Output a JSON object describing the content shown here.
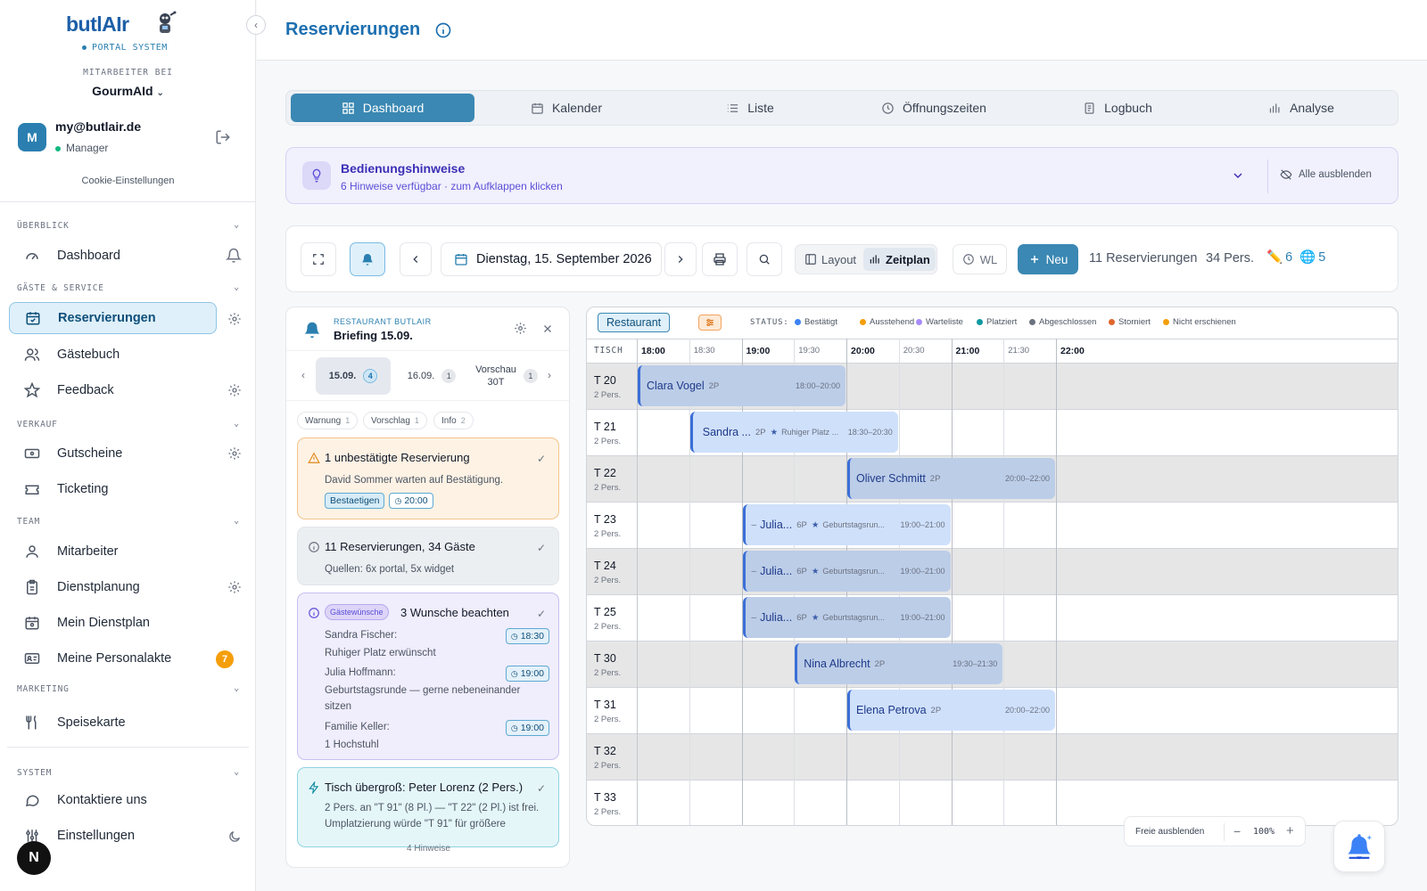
{
  "sidebar": {
    "logo": "butlAIr",
    "portal": "PORTAL SYSTEM",
    "employee_label": "MITARBEITER BEI",
    "company": "GourmAId",
    "user": {
      "initial": "M",
      "email": "my@butlair.de",
      "role": "Manager"
    },
    "cookie": "Cookie-Einstellungen",
    "sections": {
      "overview": "ÜBERBLICK",
      "guests": "GÄSTE & SERVICE",
      "sales": "VERKAUF",
      "team": "TEAM",
      "marketing": "MARKETING",
      "system": "SYSTEM"
    },
    "items": {
      "dashboard": "Dashboard",
      "reservations": "Reservierungen",
      "guestbook": "Gästebuch",
      "feedback": "Feedback",
      "vouchers": "Gutscheine",
      "ticketing": "Ticketing",
      "staff": "Mitarbeiter",
      "scheduling": "Dienstplanung",
      "myschedule": "Mein Dienstplan",
      "personnel": "Meine Personalakte",
      "menu": "Speisekarte",
      "contact": "Kontaktiere uns",
      "settings": "Einstellungen"
    },
    "personnel_badge": "7",
    "bottom_logo": "N"
  },
  "header": {
    "title": "Reservierungen"
  },
  "tabs": [
    "Dashboard",
    "Kalender",
    "Liste",
    "Öffnungszeiten",
    "Logbuch",
    "Analyse"
  ],
  "hints": {
    "title": "Bedienungshinweise",
    "subtitle": "6 Hinweise verfügbar · zum Aufklappen klicken",
    "hide_all": "Alle ausblenden"
  },
  "toolbar": {
    "date": "Dienstag, 15. September 2026",
    "layout": "Layout",
    "timeline": "Zeitplan",
    "wl": "WL",
    "new": "Neu",
    "count_res": "11 Reservierungen",
    "count_pers": "34 Pers.",
    "portal_count": "6",
    "widget_count": "5"
  },
  "briefing": {
    "restaurant": "RESTAURANT BUTLAIR",
    "title": "Briefing 15.09.",
    "days": [
      {
        "label": "15.09.",
        "count": "4"
      },
      {
        "label": "16.09.",
        "count": "1"
      },
      {
        "label": "Vorschau",
        "label2": "30T",
        "count": "1"
      }
    ],
    "filters": [
      {
        "label": "Warnung",
        "count": "1"
      },
      {
        "label": "Vorschlag",
        "count": "1"
      },
      {
        "label": "Info",
        "count": "2"
      }
    ],
    "card1": {
      "title": "1 unbestätigte Reservierung",
      "text": "David Sommer warten auf Bestätigung.",
      "confirm": "Bestaetigen",
      "time": "20:00"
    },
    "card2": {
      "title": "11 Reservierungen, 34 Gäste",
      "text": "Quellen: 6x portal, 5x widget"
    },
    "card3": {
      "tag": "Gästewünsche",
      "title": "3 Wunsche beachten",
      "wishes": [
        {
          "name": "Sandra Fischer:",
          "note": "Ruhiger Platz erwünscht",
          "time": "18:30"
        },
        {
          "name": "Julia Hoffmann:",
          "note": "Geburtstagsrunde — gerne nebeneinander sitzen",
          "time": "19:00"
        },
        {
          "name": "Familie Keller:",
          "note": "1 Hochstuhl",
          "time": "19:00"
        }
      ]
    },
    "card4": {
      "title": "Tisch übergroß: Peter Lorenz (2 Pers.)",
      "text": "2 Pers. an \"T 91\" (8 Pl.) — \"T 22\" (2 Pl.) ist frei. Umplatzierung würde \"T 91\" für größere"
    },
    "footer": "4 Hinweise"
  },
  "timeline": {
    "area": "Restaurant",
    "status_label": "STATUS:",
    "legend": [
      {
        "label": "Bestätigt",
        "color": "#3b82f6"
      },
      {
        "label": "Ausstehend",
        "color": "#f59e0b"
      },
      {
        "label": "Warteliste",
        "color": "#a78bfa"
      },
      {
        "label": "Platziert",
        "color": "#0f9aa0"
      },
      {
        "label": "Abgeschlossen",
        "color": "#6b7280"
      },
      {
        "label": "Storniert",
        "color": "#e0662f"
      },
      {
        "label": "Nicht erschienen",
        "color": "#f59e0b"
      }
    ],
    "table_header": "TISCH",
    "hours": [
      "18:00",
      "18:30",
      "19:00",
      "19:30",
      "20:00",
      "20:30",
      "21:00",
      "21:30",
      "22:00"
    ],
    "tables": [
      {
        "name": "T 20",
        "pers": "2 Pers."
      },
      {
        "name": "T 21",
        "pers": "2 Pers."
      },
      {
        "name": "T 22",
        "pers": "2 Pers."
      },
      {
        "name": "T 23",
        "pers": "2 Pers."
      },
      {
        "name": "T 24",
        "pers": "2 Pers."
      },
      {
        "name": "T 25",
        "pers": "2 Pers."
      },
      {
        "name": "T 30",
        "pers": "2 Pers."
      },
      {
        "name": "T 31",
        "pers": "2 Pers."
      },
      {
        "name": "T 32",
        "pers": "2 Pers."
      },
      {
        "name": "T 33",
        "pers": "2 Pers."
      }
    ],
    "reservations": [
      {
        "name": "Clara Vogel",
        "pers": "2P",
        "note": "",
        "time": "18:00–20:00"
      },
      {
        "name": "Sandra ...",
        "pers": "2P",
        "note": "Ruhiger Platz ...",
        "time": "18:30–20:30"
      },
      {
        "name": "Oliver Schmitt",
        "pers": "2P",
        "note": "",
        "time": "20:00–22:00"
      },
      {
        "name": "Julia...",
        "pers": "6P",
        "note": "Geburtstagsrun...",
        "time": "19:00–21:00"
      },
      {
        "name": "Julia...",
        "pers": "6P",
        "note": "Geburtstagsrun...",
        "time": "19:00–21:00"
      },
      {
        "name": "Julia...",
        "pers": "6P",
        "note": "Geburtstagsrun...",
        "time": "19:00–21:00"
      },
      {
        "name": "Nina Albrecht",
        "pers": "2P",
        "note": "",
        "time": "19:30–21:30"
      },
      {
        "name": "Elena Petrova",
        "pers": "2P",
        "note": "",
        "time": "20:00–22:00"
      }
    ]
  },
  "zoom": {
    "hide_free": "Freie ausblenden",
    "value": "100%"
  }
}
